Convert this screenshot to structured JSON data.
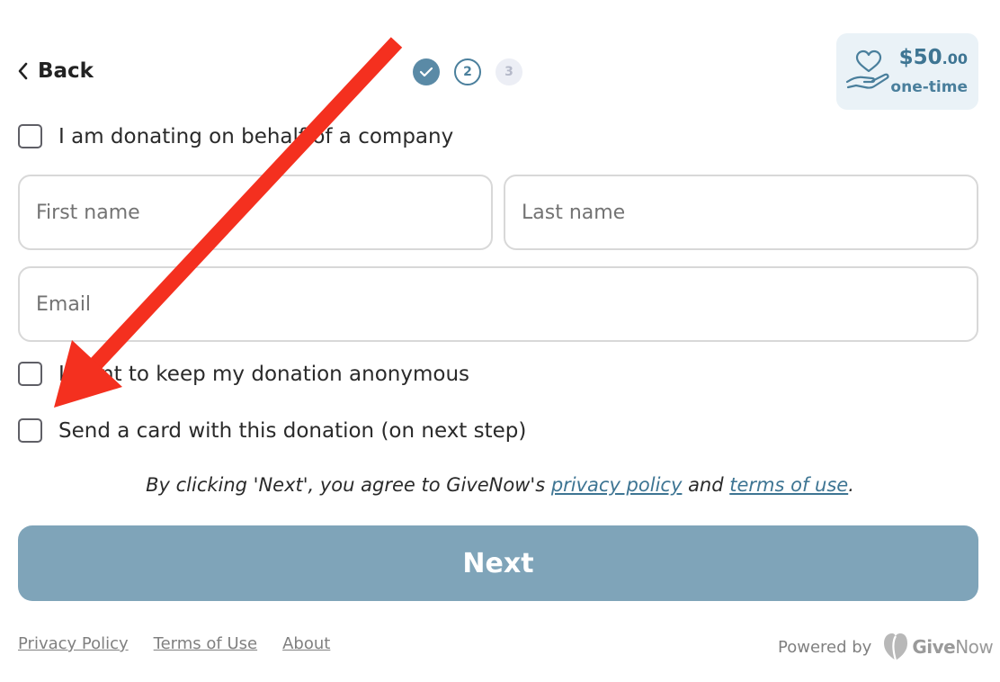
{
  "header": {
    "back_label": "Back",
    "steps": [
      {
        "label": "",
        "state": "done"
      },
      {
        "label": "2",
        "state": "current"
      },
      {
        "label": "3",
        "state": "future"
      }
    ],
    "amount": {
      "dollars": "$50",
      "cents": ".00",
      "frequency": "one-time"
    }
  },
  "form": {
    "company_checkbox_label": "I am donating on behalf of a company",
    "first_name_placeholder": "First name",
    "last_name_placeholder": "Last name",
    "email_placeholder": "Email",
    "anonymous_checkbox_label": "I want to keep my donation anonymous",
    "card_checkbox_label": "Send a card with this donation (on next step)"
  },
  "agreement": {
    "prefix": "By clicking 'Next', you agree to GiveNow's ",
    "privacy_link": "privacy policy",
    "middle": " and ",
    "terms_link": "terms of use",
    "suffix": "."
  },
  "next_button_label": "Next",
  "footer": {
    "links": [
      "Privacy Policy",
      "Terms of Use",
      "About"
    ],
    "powered_by": "Powered by",
    "brand_give": "Give",
    "brand_now": "Now"
  },
  "colors": {
    "accent": "#4a7f9c",
    "next_button": "#7fa4b9",
    "annotation_arrow": "#f4301f"
  },
  "icons": {
    "back": "chevron-left-icon",
    "step_done": "checkmark-icon",
    "amount": "hand-heart-icon",
    "brand": "givenow-logo-icon"
  }
}
